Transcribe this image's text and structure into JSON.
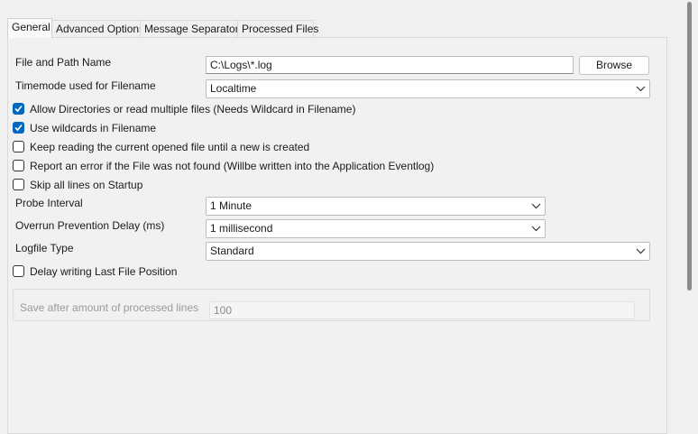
{
  "tabs": [
    {
      "label": "General",
      "active": true
    },
    {
      "label": "Advanced Options",
      "active": false
    },
    {
      "label": "Message Separators",
      "active": false
    },
    {
      "label": "Processed Files",
      "active": false
    }
  ],
  "file_path": {
    "label": "File and Path Name",
    "value": "C:\\Logs\\*.log",
    "browse_label": "Browse"
  },
  "timemode": {
    "label": "Timemode used for Filename",
    "value": "Localtime"
  },
  "checkboxes": [
    {
      "label": "Allow Directories or read multiple files (Needs Wildcard in Filename)",
      "checked": true
    },
    {
      "label": "Use wildcards in Filename",
      "checked": true
    },
    {
      "label": "Keep reading the current opened file until a new is created",
      "checked": false
    },
    {
      "label": "Report an error if the File was not found (Willbe written into the Application Eventlog)",
      "checked": false
    },
    {
      "label": "Skip all lines on Startup",
      "checked": false
    }
  ],
  "probe_interval": {
    "label": "Probe Interval",
    "value": "1 Minute"
  },
  "overrun_delay": {
    "label": "Overrun Prevention Delay (ms)",
    "value": "1 millisecond"
  },
  "logfile_type": {
    "label": "Logfile Type",
    "value": "Standard"
  },
  "delay_writing": {
    "label": "Delay writing Last File Position",
    "checked": false
  },
  "save_after": {
    "label": "Save after amount of processed lines",
    "value": "100"
  },
  "colors": {
    "accent": "#0067c0",
    "background": "#f0f0f0"
  }
}
